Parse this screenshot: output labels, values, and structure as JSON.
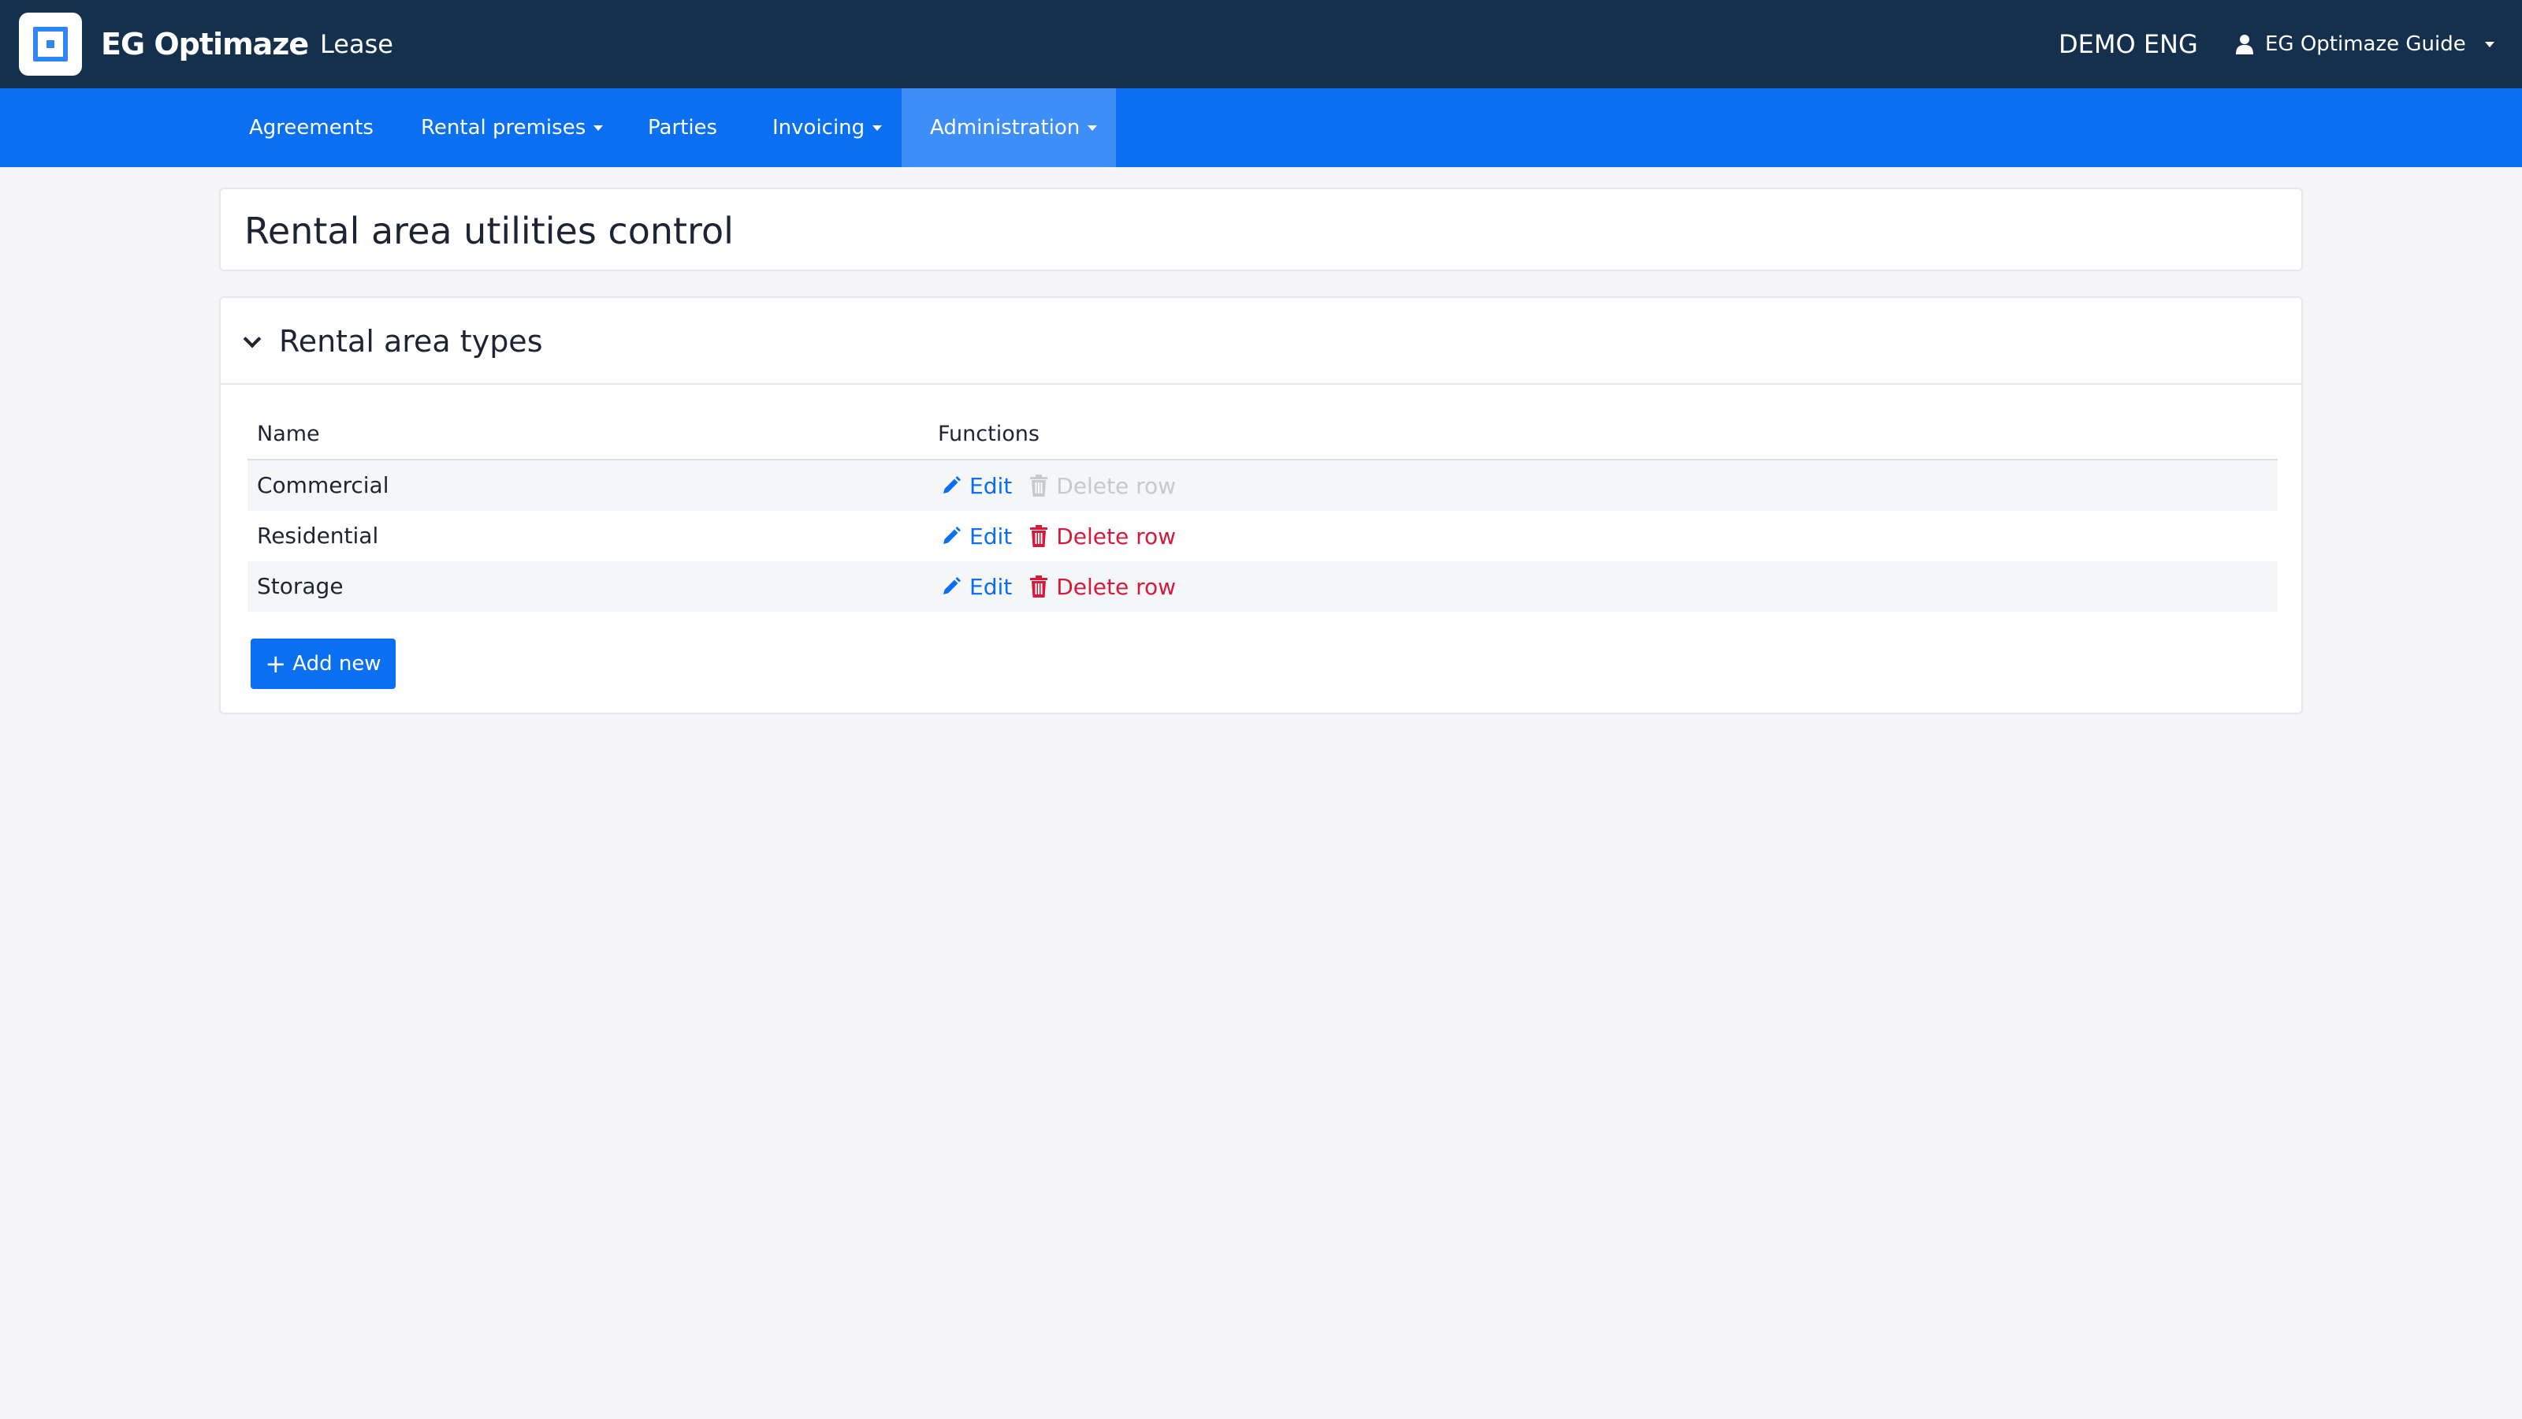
{
  "app": {
    "brand": "EG Optimaze",
    "module": "Lease",
    "tenant": "DEMO ENG",
    "user": "EG Optimaze Guide"
  },
  "nav": {
    "items": [
      {
        "label": "Agreements"
      },
      {
        "label": "Rental premises"
      },
      {
        "label": "Parties"
      },
      {
        "label": "Invoicing"
      },
      {
        "label": "Administration"
      }
    ],
    "active": "Administration"
  },
  "page": {
    "title": "Rental area utilities control"
  },
  "section": {
    "title": "Rental area types",
    "columns": {
      "name": "Name",
      "functions": "Functions"
    },
    "rows": [
      {
        "name": "Commercial",
        "edit": "Edit",
        "delete": "Delete row",
        "delete_disabled": true
      },
      {
        "name": "Residential",
        "edit": "Edit",
        "delete": "Delete row",
        "delete_disabled": false
      },
      {
        "name": "Storage",
        "edit": "Edit",
        "delete": "Delete row",
        "delete_disabled": false
      }
    ],
    "add_label": "Add new"
  },
  "colors": {
    "topbar": "#14304d",
    "navbar": "#0a6ff0",
    "nav_active": "#3d8ff7",
    "edit": "#0a6ff0",
    "delete": "#d41b3c",
    "disabled": "#c7c9cd"
  },
  "icons": {
    "logo": "eg-logo-icon",
    "user": "user-icon",
    "caret": "caret-down-icon",
    "collapse": "chevron-down-icon",
    "edit": "pencil-icon",
    "delete": "trash-icon",
    "add": "plus-icon"
  }
}
